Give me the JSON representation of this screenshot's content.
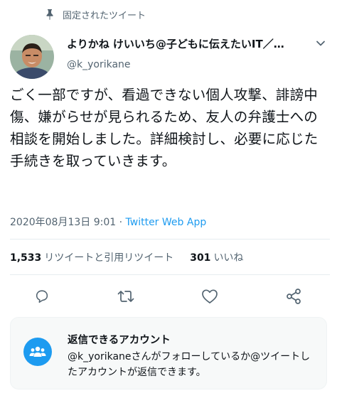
{
  "pinned": {
    "label": "固定されたツイート",
    "icon": "pin-icon"
  },
  "author": {
    "display_name": "よりかね けいいち@子どもに伝えたいIT／メデ…",
    "handle": "@k_yorikane",
    "avatar": "avatar-photo"
  },
  "tweet": {
    "text": "ごく一部ですが、看過できない個人攻撃、誹謗中傷、嫌がらせが見られるため、友人の弁護士への相談を開始しました。詳細検討し、必要に応じた手続きを取っていきます。",
    "timestamp": "2020年08月13日 9:01",
    "separator": "·",
    "source": "Twitter Web App"
  },
  "stats": {
    "retweets_count": "1,533",
    "retweets_label": "リツイートと引用リツイート",
    "likes_count": "301",
    "likes_label": "いいね"
  },
  "actions": [
    {
      "name": "reply-button",
      "icon": "reply-icon"
    },
    {
      "name": "retweet-button",
      "icon": "retweet-icon"
    },
    {
      "name": "like-button",
      "icon": "heart-icon"
    },
    {
      "name": "share-button",
      "icon": "share-icon"
    }
  ],
  "reply_restriction": {
    "title": "返信できるアカウント",
    "description": "@k_yorikaneさんがフォローしているか@ツイートしたアカウントが返信できます。",
    "icon": "people-icon"
  },
  "colors": {
    "accent": "#1d9bf0",
    "secondary_text": "#536471",
    "icon_gray": "#536471"
  }
}
